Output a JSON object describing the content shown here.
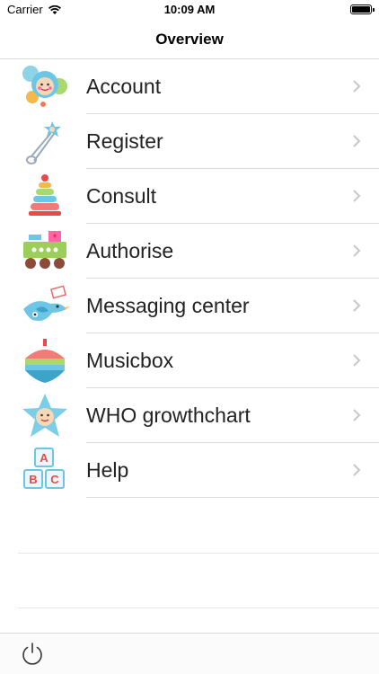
{
  "status_bar": {
    "carrier": "Carrier",
    "time": "10:09 AM"
  },
  "nav": {
    "title": "Overview"
  },
  "menu": [
    {
      "label": "Account",
      "icon": "baby-face-icon"
    },
    {
      "label": "Register",
      "icon": "safety-pin-icon"
    },
    {
      "label": "Consult",
      "icon": "stacking-rings-icon"
    },
    {
      "label": "Authorise",
      "icon": "toy-train-icon"
    },
    {
      "label": "Messaging center",
      "icon": "bird-letter-icon"
    },
    {
      "label": "Musicbox",
      "icon": "spinning-top-icon"
    },
    {
      "label": "WHO growthchart",
      "icon": "star-face-icon"
    },
    {
      "label": "Help",
      "icon": "abc-blocks-icon"
    }
  ],
  "toolbar": {
    "icon": "power-icon"
  },
  "colors": {
    "separator": "#dcdcdc",
    "chevron": "#c7c7cc"
  }
}
